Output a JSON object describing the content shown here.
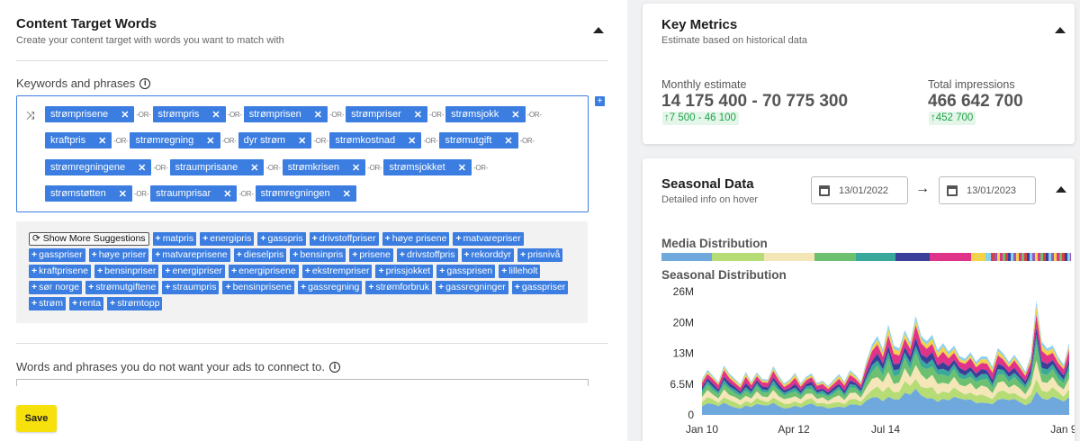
{
  "content_target": {
    "title": "Content Target Words",
    "subtitle": "Create your content target with words you want to match with",
    "keywords_label": "Keywords and phrases",
    "or_text": "-OR-",
    "keyword_rows": [
      [
        "strømprisene",
        "strømpris",
        "strømprisen",
        "strømpriser",
        "strømsjokk"
      ],
      [
        "kraftpris",
        "strømregning",
        "dyr strøm",
        "strømkostnad",
        "strømutgift"
      ],
      [
        "strømregningene",
        "straumprisane",
        "strømkrisen",
        "strømsjokket"
      ],
      [
        "strømstøtten",
        "straumprisar",
        "strømregningen"
      ]
    ],
    "show_more_label": "Show More Suggestions",
    "suggestions": [
      "matpris",
      "energipris",
      "gasspris",
      "drivstoffpriser",
      "høye prisene",
      "matvarepriser",
      "gasspriser",
      "høye priser",
      "matvareprisene",
      "dieselpris",
      "bensinpris",
      "prisene",
      "drivstoffpris",
      "rekorddyr",
      "prisnivå",
      "kraftprisene",
      "bensinpriser",
      "energipriser",
      "energiprisene",
      "ekstrempriser",
      "prissjokket",
      "gassprisen",
      "lilleholt",
      "sør norge",
      "strømutgiftene",
      "straumpris",
      "bensinprisene",
      "gassregning",
      "strømforbruk",
      "gassregninger",
      "gasspriser",
      "strøm",
      "renta",
      "strømtopp"
    ],
    "negative_label": "Words and phrases you do not want your ads to connect to.",
    "save_label": "Save"
  },
  "key_metrics": {
    "title": "Key Metrics",
    "subtitle": "Estimate based on historical data",
    "monthly_label": "Monthly estimate",
    "monthly_value": "14 175 400 - 70 775 300",
    "monthly_delta": "7 500 - 46 100",
    "impressions_label": "Total impressions",
    "impressions_value": "466 642 700",
    "impressions_delta": "452 700"
  },
  "seasonal": {
    "title": "Seasonal Data",
    "subtitle": "Detailed info on hover",
    "date_from": "13/01/2022",
    "date_to": "13/01/2023",
    "media_label": "Media Distribution",
    "media_colors": [
      "#6fa8dc",
      "#b6dc76",
      "#f5e6b8",
      "#6cc070",
      "#3aa89a",
      "#3a3f9a",
      "#e0338a",
      "#f2d34a",
      "#8bd0f0",
      "#d94040",
      "#9b59b6",
      "#2e8b57"
    ],
    "seasonal_label": "Seasonal Distribution"
  },
  "chart_data": {
    "type": "area",
    "stacked": true,
    "y_ticks": [
      "26M",
      "20M",
      "13M",
      "6.5M",
      "0"
    ],
    "x_ticks": [
      "Jan 10",
      "Apr 12",
      "Jul 14",
      "Jan 9"
    ],
    "ylim": [
      0,
      26000000
    ],
    "series_colors": [
      "#6fa8dc",
      "#b6dc76",
      "#f5e6b8",
      "#6cc070",
      "#3aa89a",
      "#3a3f9a",
      "#e0338a",
      "#f2d34a",
      "#8bd0f0"
    ],
    "total": [
      7.5,
      9.2,
      8.1,
      6.7,
      10.3,
      8.8,
      7.9,
      6.6,
      9.4,
      6.9,
      8.7,
      7.4,
      7.2,
      10.1,
      8.3,
      6.9,
      7.6,
      9.2,
      6.5,
      7.8,
      8.6,
      6.5,
      7.1,
      6.2,
      7.6,
      8.8,
      7.3,
      9.1,
      8.2,
      6.9,
      11.0,
      14.6,
      16.8,
      14.3,
      19.5,
      15.2,
      13.4,
      17.3,
      15.1,
      20.2,
      16.4,
      15.7,
      17.5,
      14.0,
      15.8,
      12.6,
      14.1,
      12.2,
      11.5,
      13.0,
      11.3,
      12.8,
      12.6,
      10.6,
      13.2,
      12.5,
      11.0,
      12.3,
      10.8,
      9.2,
      13.0,
      24.8,
      16.2,
      13.0,
      14.1,
      12.0,
      10.3,
      15.0
    ]
  }
}
